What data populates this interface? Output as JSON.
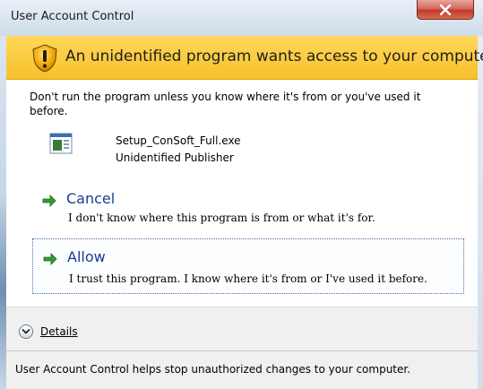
{
  "window": {
    "title": "User Account Control"
  },
  "banner": {
    "text": "An unidentified program wants access to your computer"
  },
  "warning": "Don't run the program unless you know where it's from or you've used it before.",
  "program": {
    "name": "Setup_ConSoft_Full.exe",
    "publisher": "Unidentified Publisher"
  },
  "options": [
    {
      "title": "Cancel",
      "description": "I don't know where this program is from or what it's for."
    },
    {
      "title": "Allow",
      "description": "I trust this program. I know where it's from or I've used it before."
    }
  ],
  "details": {
    "label": "Details"
  },
  "footer": "User Account Control helps stop unauthorized changes to your computer.",
  "colors": {
    "banner": "#f7c02a",
    "option_link": "#1a3d8f",
    "arrow": "#2e9e2e",
    "close": "#c0392b"
  },
  "icons": {
    "close": "close-icon",
    "shield": "uac-shield-icon",
    "program": "program-icon",
    "arrow": "green-arrow-icon",
    "details": "chevron-down-icon"
  }
}
